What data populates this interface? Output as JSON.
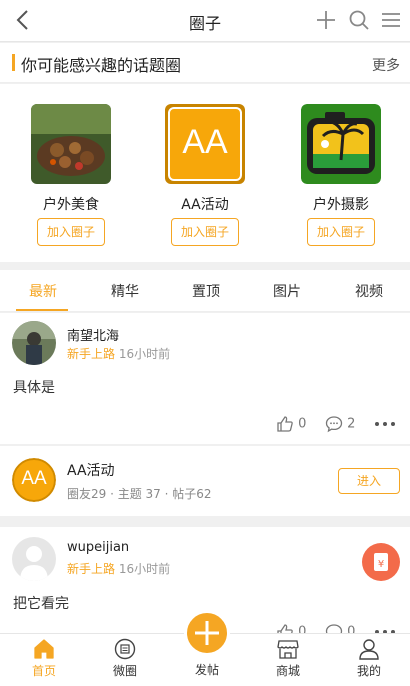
{
  "header": {
    "title": "圈子"
  },
  "section": {
    "title": "你可能感兴趣的话题圈",
    "more": "更多"
  },
  "circles": [
    {
      "name": "户外美食",
      "join": "加入圈子"
    },
    {
      "name": "AA活动",
      "join": "加入圈子",
      "logo_text": "AA"
    },
    {
      "name": "户外摄影",
      "join": "加入圈子"
    }
  ],
  "tabs": [
    "最新",
    "精华",
    "置顶",
    "图片",
    "视频"
  ],
  "posts": [
    {
      "user": "南望北海",
      "level": "新手上路",
      "time": "16小时前",
      "text": "具体是",
      "likes": "0",
      "comments": "2"
    },
    {
      "user": "wupeijian",
      "level": "新手上路",
      "time": "16小时前",
      "text": "把它看完",
      "likes": "0",
      "comments": "0"
    }
  ],
  "circle_card": {
    "name": "AA活动",
    "logo_text": "AA",
    "stats": "圈友29 · 主题 37 · 帖子62",
    "enter": "进入"
  },
  "nav": {
    "home": "首页",
    "weiquan": "微圈",
    "post": "发帖",
    "mall": "商城",
    "me": "我的"
  },
  "colors": {
    "accent": "#f5a623",
    "red": "#f36b4a"
  }
}
